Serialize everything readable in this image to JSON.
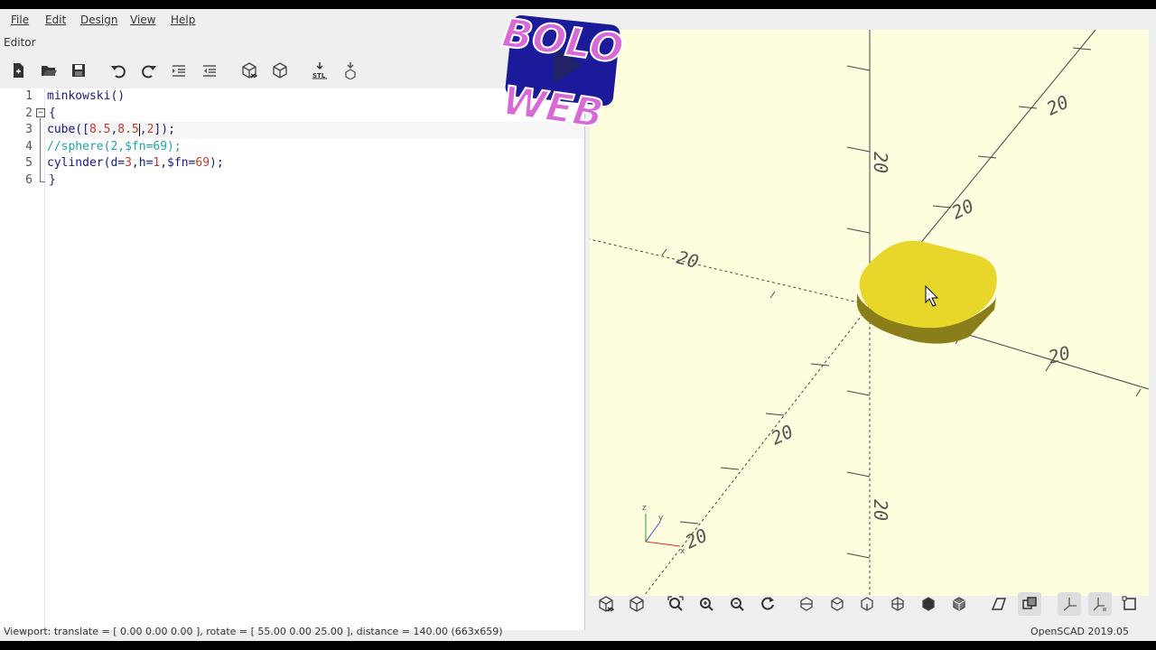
{
  "menu": {
    "file": "File",
    "edit": "Edit",
    "design": "Design",
    "view": "View",
    "help": "Help"
  },
  "editor_label": "Editor",
  "toolbar": {
    "icons": [
      "new-file-icon",
      "open-file-icon",
      "save-icon",
      "undo-icon",
      "redo-icon",
      "indent-icon",
      "unindent-icon",
      "preview-icon",
      "render-icon",
      "export-stl-icon",
      "send-to-print-icon"
    ],
    "stl_label": "STL"
  },
  "code": {
    "line_numbers": [
      "1",
      "2",
      "3",
      "4",
      "5",
      "6"
    ],
    "line1": "minkowski()",
    "line2": "{",
    "line3_pre": "cube([",
    "line3_n1": "8.5",
    "line3_c1": ",",
    "line3_n2": "8.5",
    "line3_c2": ",",
    "line3_n3": "2",
    "line3_post": "]);",
    "line4": "//sphere(2,$fn=69);",
    "line5_pre": "cylinder(d=",
    "line5_n1": "3",
    "line5_mid1": ",h=",
    "line5_n2": "1",
    "line5_mid2": ",$fn=",
    "line5_n3": "69",
    "line5_post": ");",
    "line6": "}"
  },
  "viewport": {
    "background": "#fefedf",
    "object_color": "#e8d62a",
    "axis_labels": [
      "20",
      "20",
      "20",
      "20",
      "20",
      "20",
      "20",
      "20"
    ],
    "small_axis": {
      "x": "x",
      "y": "y",
      "z": "z"
    }
  },
  "logo": {
    "line1": "BOLO",
    "line2": "WEB"
  },
  "viewport_toolbar": {
    "icons": [
      "preview-icon",
      "render-icon",
      "zoom-all-icon",
      "zoom-in-icon",
      "zoom-out-icon",
      "reset-view-icon",
      "view-right-icon",
      "view-top-icon",
      "view-bottom-icon",
      "view-left-icon",
      "view-front-icon",
      "view-back-icon",
      "perspective-icon",
      "orthogonal-icon",
      "show-axes-icon",
      "show-scale-icon",
      "show-edges-icon"
    ]
  },
  "status": {
    "viewport_info": "Viewport: translate = [ 0.00 0.00 0.00 ], rotate = [ 55.00 0.00 25.00 ], distance = 140.00 (663x659)",
    "version": "OpenSCAD 2019.05"
  }
}
